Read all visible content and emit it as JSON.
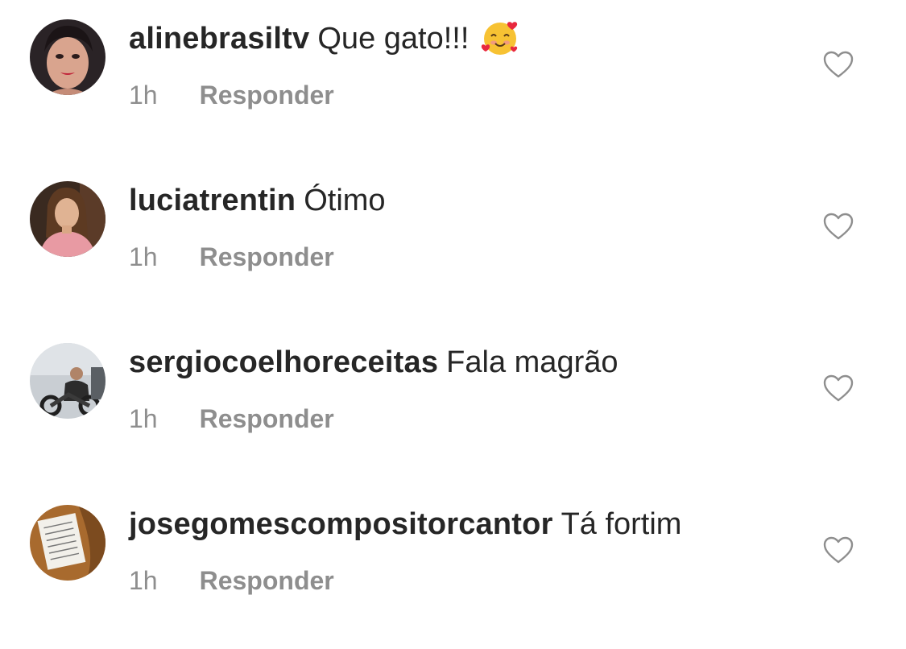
{
  "colors": {
    "text": "#262626",
    "secondary": "#8e8e8e",
    "heart_outline": "#8e8e8e"
  },
  "comments": [
    {
      "username": "alinebrasiltv",
      "text": "Que gato!!!",
      "emoji": "smiling-face-with-hearts-icon",
      "time": "1h",
      "reply": "Responder"
    },
    {
      "username": "luciatrentin",
      "text": "Ótimo",
      "time": "1h",
      "reply": "Responder"
    },
    {
      "username": "sergiocoelhoreceitas",
      "text": "Fala magrão",
      "time": "1h",
      "reply": "Responder"
    },
    {
      "username": "josegomescompositorcantor",
      "text": "Tá fortim",
      "time": "1h",
      "reply": "Responder"
    }
  ]
}
